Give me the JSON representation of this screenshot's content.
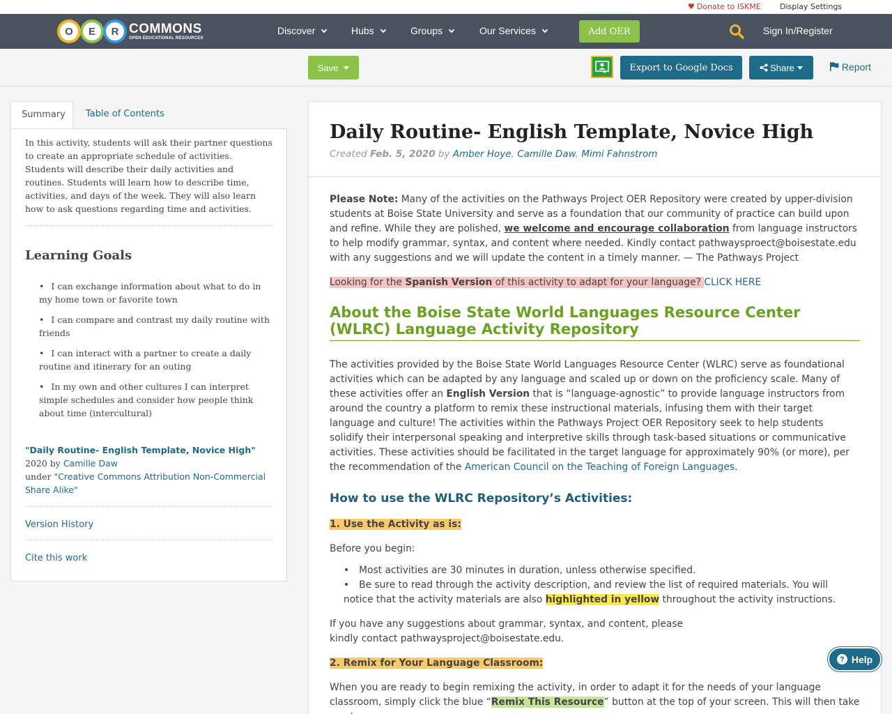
{
  "utility": {
    "donate": "Donate to ISKME",
    "display_settings": "Display Settings"
  },
  "logo": {
    "letters": [
      "O",
      "E",
      "R"
    ],
    "name": "COMMONS",
    "tagline": "OPEN EDUCATIONAL RESOURCES"
  },
  "nav": {
    "items": [
      "Discover",
      "Hubs",
      "Groups",
      "Our Services"
    ],
    "add_oer": "Add OER",
    "sign_in": "Sign In/Register"
  },
  "toolbar": {
    "save": "Save",
    "export": "Export to Google Docs",
    "share": "Share",
    "report": "Report"
  },
  "sidebar": {
    "tabs": [
      "Summary",
      "Table of Contents"
    ],
    "summary": "In this activity, students will ask their partner questions to create an appropriate schedule of activities. Students will describe their daily activities and routines. Students will learn how to describe time, activities, and days of the week. They will also learn how to ask questions regarding time and activities.",
    "goals_heading": "Learning Goals",
    "goals": [
      "I can exchange information about what to do in my home town or favorite town",
      "I can compare and contrast my daily routine with friends",
      "I can interact with a partner to create a daily routine and itinerary for an outing",
      "In my own and other cultures I can interpret simple schedules and consider how people think about time (intercultural)"
    ],
    "attribution": {
      "title": "\"Daily Routine- English Template, Novice High\"",
      "year_by": " 2020 by ",
      "author": "Camille Daw",
      "under": "under ",
      "license": "\"Creative Commons Attribution Non-Commercial Share Alike\""
    },
    "version_history": "Version History",
    "cite": "Cite this work"
  },
  "content": {
    "title": "Daily Routine- English Template, Novice High",
    "created_label": "Created ",
    "date": "Feb. 5, 2020",
    "by": " by ",
    "authors": [
      "Amber Hoye",
      "Camille Daw",
      "Mimi Fahnstrom"
    ],
    "note_label": "Please Note:",
    "note_1": " Many of the activities on the Pathways Project OER Repository were created by upper-division students at Boise State University and serve as a foundation that our community of practice can build upon and refine. While they are polished, ",
    "note_emph": "we welcome and encourage collaboration",
    "note_2": " from language instructors to help modify grammar, syntax, and content where needed. Kindly contact pathwaysproect@boisestate.edu with any suggestions and we will update the content in a timely manner.  — The Pathways Project",
    "spanish_1": "Looking for the ",
    "spanish_bold": "Spanish Version",
    "spanish_2": " of this activity to adapt for your language? ",
    "click_here": "CLICK HERE",
    "about_heading": "About the Boise State World Languages Resource Center (WLRC) Language Activity Repository",
    "about_1": "The activities provided by the Boise State World Languages Resource Center (WLRC) serve as foundational activities which can be adapted by any language and scaled up or down on the proficiency scale. Many of these activities offer an ",
    "about_bold": "English Version",
    "about_2": " that is “language-agnostic” to provide language instructors from around the country a platform to remix these instructional materials, infusing them with their target language and culture! The activities within the Pathways Project OER Repository seek to help students solidify their interpersonal speaking and interpretive skills through task-based situations or communicative activities. These activities should be facilitated in the target language for approximately 90% (or more), per the recommendation of the ",
    "about_link": "American Council on the Teaching of Foreign Languages",
    "about_end": ".",
    "howto_heading": "How to use the WLRC Repository’s Activities:",
    "step1": "1. Use the Activity as is:",
    "before": "Before you begin:",
    "bullet1": "Most activities are 30 minutes in duration, unless otherwise specified.",
    "bullet2_a": "Be sure to read through the activity description, and review the list of required materials. You will notice that the activity materials are also ",
    "bullet2_hl": "highlighted in yellow",
    "bullet2_b": " throughout the activity instructions.",
    "suggestions": "If you have any suggestions about grammar, syntax, and content, please kindly contact pathwaysproject@boisestate.edu.",
    "step2": "2. Remix for Your Language Classroom:",
    "remix_1": "When you are ready to begin remixing the activity, in order to adapt it for the needs of your language classroom, simply click the blue “",
    "remix_hl": "Remix This Resource",
    "remix_2": "” button at the top of your screen. This will then take you to a screen"
  },
  "help": "Help",
  "colors": {
    "nav_bg": "#4a5260",
    "accent_green": "#8bc34a",
    "accent_blue": "#1d6a8a",
    "heading_green": "#6aa121"
  }
}
